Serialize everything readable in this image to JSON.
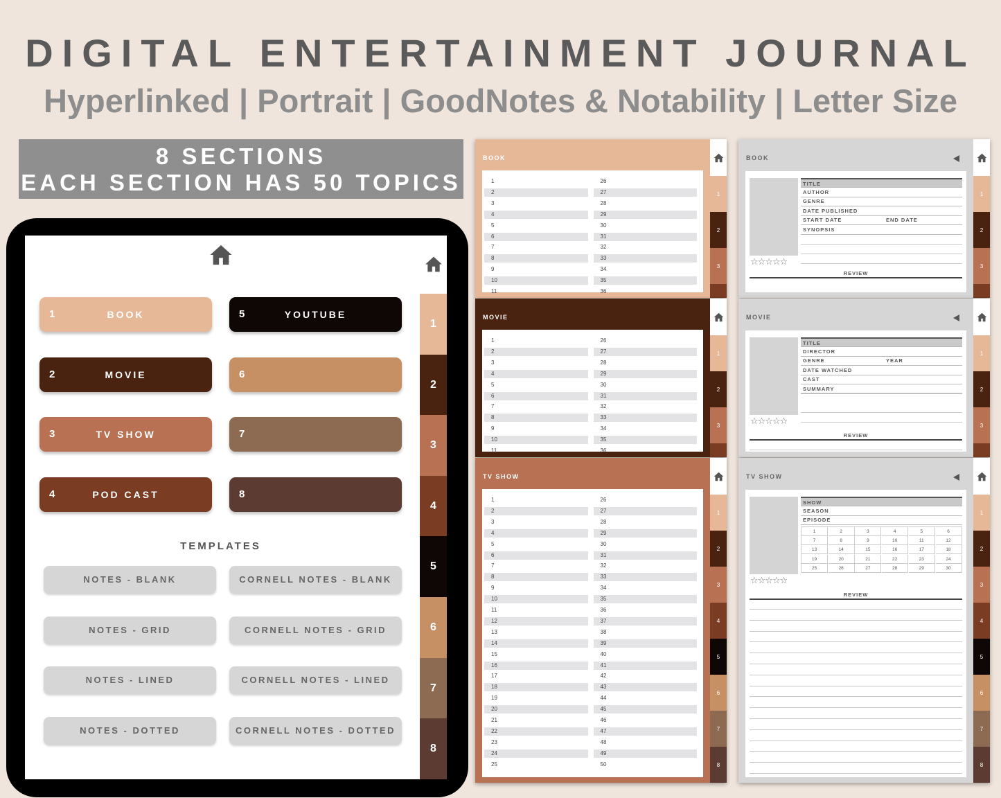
{
  "header": {
    "title": "DIGITAL ENTERTAINMENT JOURNAL",
    "subtitle": "Hyperlinked | Portrait | GoodNotes & Notability | Letter Size"
  },
  "banner": {
    "line1": "8 SECTIONS",
    "line2": "EACH SECTION HAS 50 TOPICS"
  },
  "colors": {
    "tab1": "#e6b898",
    "tab2": "#4a2210",
    "tab3": "#b87152",
    "tab4": "#7a3c22",
    "tab5": "#0f0606",
    "tab6": "#c78f64",
    "tab7": "#8c6b52",
    "tab8": "#5c3b32",
    "gray_header": "#d6d6d6"
  },
  "tablet": {
    "side_tabs": [
      "1",
      "2",
      "3",
      "4",
      "5",
      "6",
      "7",
      "8"
    ],
    "sections": [
      {
        "num": "1",
        "label": "BOOK"
      },
      {
        "num": "2",
        "label": "MOVIE"
      },
      {
        "num": "3",
        "label": "TV SHOW"
      },
      {
        "num": "4",
        "label": "POD CAST"
      },
      {
        "num": "5",
        "label": "YOUTUBE"
      },
      {
        "num": "6",
        "label": ""
      },
      {
        "num": "7",
        "label": ""
      },
      {
        "num": "8",
        "label": ""
      }
    ],
    "templates_heading": "TEMPLATES",
    "templates": [
      "NOTES - BLANK",
      "CORNELL NOTES - BLANK",
      "NOTES - GRID",
      "CORNELL NOTES - GRID",
      "NOTES - LINED",
      "CORNELL NOTES - LINED",
      "NOTES - DOTTED",
      "CORNELL NOTES - DOTTED"
    ]
  },
  "pages": {
    "book_list": {
      "title": "BOOK"
    },
    "movie_list": {
      "title": "MOVIE"
    },
    "tv_list": {
      "title": "TV SHOW"
    },
    "book_detail": {
      "title": "BOOK",
      "fields": [
        "TITLE",
        "AUTHOR",
        "GENRE",
        "DATE PUBLISHED",
        "START DATE",
        "SYNOPSIS"
      ],
      "end_date": "END DATE",
      "stars": "☆☆☆☆☆",
      "review": "REVIEW"
    },
    "movie_detail": {
      "title": "MOVIE",
      "fields": [
        "TITLE",
        "DIRECTOR",
        "GENRE",
        "DATE WATCHED",
        "CAST",
        "SUMMARY"
      ],
      "year": "YEAR",
      "stars": "☆☆☆☆☆",
      "review": "REVIEW"
    },
    "tv_detail": {
      "title": "TV SHOW",
      "fields": [
        "SHOW",
        "SEASON",
        "EPISODE"
      ],
      "stars": "☆☆☆☆☆",
      "review": "REVIEW",
      "episodes": [
        "1",
        "2",
        "3",
        "4",
        "5",
        "6",
        "7",
        "8",
        "9",
        "10",
        "11",
        "12",
        "13",
        "14",
        "15",
        "16",
        "17",
        "18",
        "19",
        "20",
        "21",
        "22",
        "23",
        "24",
        "25",
        "26",
        "27",
        "28",
        "29",
        "30"
      ]
    }
  }
}
